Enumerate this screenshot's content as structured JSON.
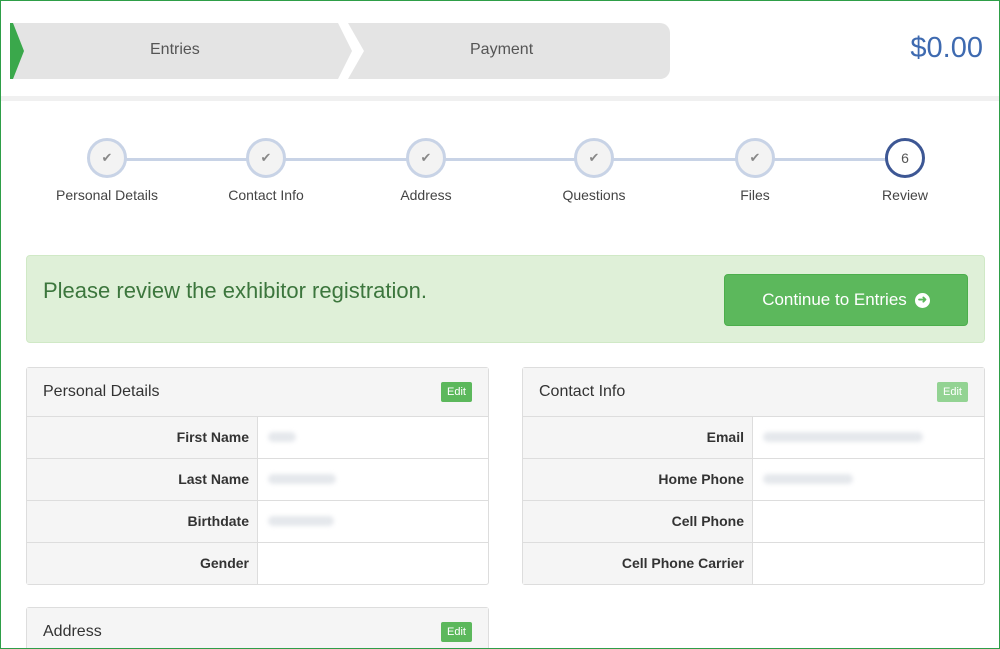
{
  "header": {
    "tabs": [
      {
        "label": "Entries"
      },
      {
        "label": "Payment"
      }
    ],
    "total": "$0.00"
  },
  "progress": {
    "steps": [
      {
        "label": "Personal Details",
        "state": "done",
        "icon": "check-icon"
      },
      {
        "label": "Contact Info",
        "state": "done",
        "icon": "check-icon"
      },
      {
        "label": "Address",
        "state": "done",
        "icon": "check-icon"
      },
      {
        "label": "Questions",
        "state": "done",
        "icon": "check-icon"
      },
      {
        "label": "Files",
        "state": "done",
        "icon": "check-icon"
      },
      {
        "label": "Review",
        "state": "active",
        "number": "6"
      }
    ]
  },
  "alert": {
    "message": "Please review the exhibitor registration.",
    "button_label": "Continue to Entries",
    "button_icon": "arrow-circle-right-icon"
  },
  "panels": {
    "personal": {
      "title": "Personal Details",
      "edit_label": "Edit",
      "rows": [
        {
          "label": "First Name",
          "value": ""
        },
        {
          "label": "Last Name",
          "value": ""
        },
        {
          "label": "Birthdate",
          "value": ""
        },
        {
          "label": "Gender",
          "value": ""
        }
      ]
    },
    "contact": {
      "title": "Contact Info",
      "edit_label": "Edit",
      "rows": [
        {
          "label": "Email",
          "value": ""
        },
        {
          "label": "Home Phone",
          "value": ""
        },
        {
          "label": "Cell Phone",
          "value": ""
        },
        {
          "label": "Cell Phone Carrier",
          "value": ""
        }
      ]
    },
    "address": {
      "title": "Address",
      "edit_label": "Edit"
    }
  },
  "colors": {
    "accent_green": "#5cb85c",
    "alert_bg": "#dff0d8",
    "alert_text": "#3c763d",
    "total_blue": "#3e6ab0",
    "active_step": "#3d5794"
  }
}
